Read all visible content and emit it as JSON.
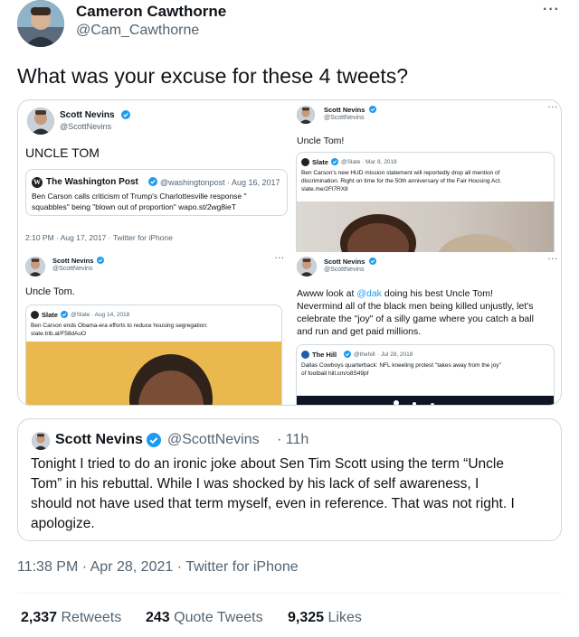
{
  "tweet": {
    "author_name": "Cameron Cawthorne",
    "author_handle": "@Cam_Cawthorne",
    "more": "···",
    "text": "What was your excuse for these 4 tweets?"
  },
  "collage": {
    "tl": {
      "name": "Scott Nevins",
      "handle": "@ScottNevins",
      "text": "UNCLE TOM",
      "quote": {
        "source": "The Washington Post",
        "handle": "@washingtonpost",
        "date": "· Aug 16, 2017",
        "text": "Ben Carson calls criticism of Trump's Charlottesville response \"",
        "text2": "squabbles\" being \"blown out of proportion\" wapo.st/2wg8ieT"
      },
      "meta": "2:10 PM · Aug 17, 2017 · Twitter for iPhone"
    },
    "tr": {
      "name": "Scott Nevins",
      "handle": "@ScottNevins",
      "more": "···",
      "text": "Uncle Tom!",
      "quote": {
        "source": "Slate",
        "handle": "@Slate",
        "date": "· Mar 8, 2018",
        "line1": "Ben Carson's new HUD mission statement will reportedly drop all mention of",
        "line2": "discrimination. Right on time for the 50th anniversary of the Fair Housing Act.",
        "line3": "slate.me/2Fl7RX8"
      }
    },
    "bl": {
      "name": "Scott Nevins",
      "handle": "@ScottNevins",
      "more": "···",
      "text": "Uncle Tom.",
      "quote": {
        "source": "Slate",
        "handle": "@Slate",
        "date": "· Aug 14, 2018",
        "line1": "Ben Carson ends Obama-era efforts to reduce housing segregation:",
        "line2": "slate.trib.al/F58dAuO"
      }
    },
    "br": {
      "name": "Scott Nevins",
      "handle": "@ScottNevins",
      "more": "···",
      "text_pre": "Awww look at ",
      "mention": "@dak",
      "text_post": " doing his best Uncle Tom!",
      "line2": "Nevermind all of the black men being killed unjustly, let's",
      "line3": "celebrate the \"joy\" of a silly game where you catch a ball",
      "line4": "and run and get paid millions.",
      "quote": {
        "source": "The Hill",
        "handle": "@thehill",
        "date": "· Jul 28, 2018",
        "line1": "Dallas Cowboys quarterback: NFL kneeling protest \"takes away from the joy\"",
        "line2": "of football hill.cm/o8S49pf"
      }
    }
  },
  "quoted": {
    "name": "Scott Nevins",
    "handle": "@ScottNevins",
    "time": "· 11h",
    "line1": "Tonight I tried to do an ironic joke about Sen Tim Scott using the term “Uncle",
    "line2": "Tom” in his rebuttal. While I was shocked by his lack of self awareness, I",
    "line3": "should not have used that term myself, even in reference. That was not right. I",
    "line4": "apologize."
  },
  "meta": "11:38 PM · Apr 28, 2021 · Twitter for iPhone",
  "stats": {
    "retweets_count": "2,337",
    "retweets_label": "Retweets",
    "quotes_count": "243",
    "quotes_label": "Quote Tweets",
    "likes_count": "9,325",
    "likes_label": "Likes"
  },
  "colors": {
    "link": "#1d9bf0",
    "verified": "#1d9bf0",
    "border": "#cfd9de",
    "muted": "#536471"
  }
}
